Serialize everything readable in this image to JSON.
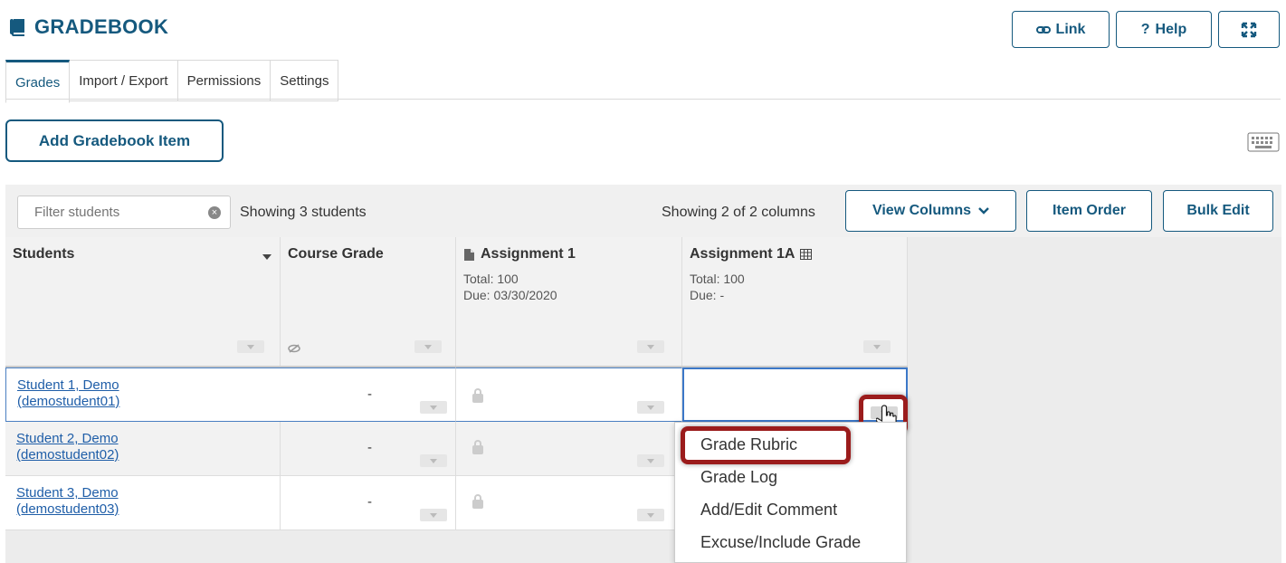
{
  "header": {
    "title": "GRADEBOOK",
    "link_label": "Link",
    "help_label": "Help"
  },
  "tabs": [
    "Grades",
    "Import / Export",
    "Permissions",
    "Settings"
  ],
  "add_item_label": "Add Gradebook Item",
  "toolbar": {
    "filter_placeholder": "Filter students",
    "showing_students": "Showing 3 students",
    "showing_columns": "Showing 2 of 2 columns",
    "view_columns_label": "View Columns",
    "item_order_label": "Item Order",
    "bulk_edit_label": "Bulk Edit"
  },
  "columns": {
    "students": "Students",
    "course_grade": "Course Grade",
    "assignment1": {
      "title": "Assignment 1",
      "total": "Total: 100",
      "due": "Due: 03/30/2020"
    },
    "assignment1a": {
      "title": "Assignment 1A",
      "total": "Total: 100",
      "due": "Due: -"
    }
  },
  "rows": [
    {
      "name": "Student 1, Demo",
      "id": "(demostudent01)",
      "course_grade": "-"
    },
    {
      "name": "Student 2, Demo",
      "id": "(demostudent02)",
      "course_grade": "-"
    },
    {
      "name": "Student 3, Demo",
      "id": "(demostudent03)",
      "course_grade": "-"
    }
  ],
  "menu": [
    "Grade Rubric",
    "Grade Log",
    "Add/Edit Comment",
    "Excuse/Include Grade"
  ],
  "colors": {
    "brand": "#15597e",
    "highlight": "#9b1c1c",
    "link": "#1f5ea8"
  }
}
